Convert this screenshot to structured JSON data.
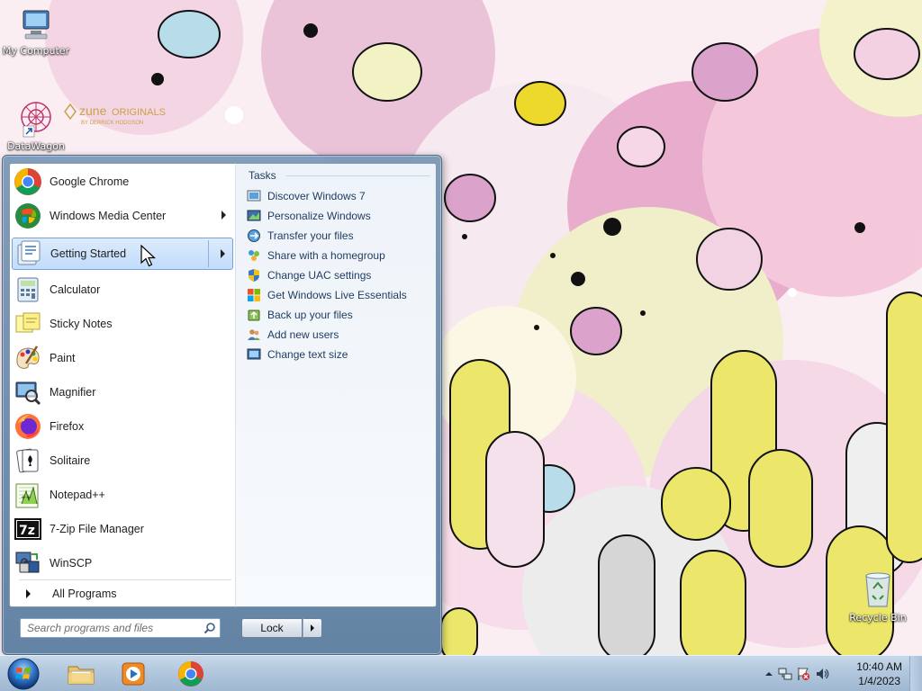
{
  "desktop": {
    "icons": [
      {
        "label": "My Computer",
        "icon": "computer-icon"
      },
      {
        "label": "DataWagon",
        "icon": "datawagon-shortcut-icon"
      },
      {
        "label": "Recycle Bin",
        "icon": "recycle-bin-icon"
      }
    ],
    "zune_logo": {
      "brand": "zune",
      "tagline": "ORIGINALS",
      "credit": "BY DERRICK HODGSON"
    }
  },
  "start_menu": {
    "programs": [
      {
        "label": "Google Chrome",
        "icon": "chrome-icon",
        "has_submenu": false,
        "selected": false
      },
      {
        "label": "Windows Media Center",
        "icon": "media-center-icon",
        "has_submenu": true,
        "selected": false
      },
      {
        "label": "Getting Started",
        "icon": "getting-started-icon",
        "has_submenu": true,
        "selected": true
      },
      {
        "label": "Calculator",
        "icon": "calculator-icon",
        "has_submenu": false,
        "selected": false
      },
      {
        "label": "Sticky Notes",
        "icon": "sticky-notes-icon",
        "has_submenu": false,
        "selected": false
      },
      {
        "label": "Paint",
        "icon": "paint-icon",
        "has_submenu": false,
        "selected": false
      },
      {
        "label": "Magnifier",
        "icon": "magnifier-icon",
        "has_submenu": false,
        "selected": false
      },
      {
        "label": "Firefox",
        "icon": "firefox-icon",
        "has_submenu": false,
        "selected": false
      },
      {
        "label": "Solitaire",
        "icon": "solitaire-icon",
        "has_submenu": false,
        "selected": false
      },
      {
        "label": "Notepad++",
        "icon": "notepad-plus-plus-icon",
        "has_submenu": false,
        "selected": false
      },
      {
        "label": "7-Zip File Manager",
        "icon": "7zip-icon",
        "has_submenu": false,
        "selected": false
      },
      {
        "label": "WinSCP",
        "icon": "winscp-icon",
        "has_submenu": false,
        "selected": false
      }
    ],
    "all_programs_label": "All Programs",
    "tasks_title": "Tasks",
    "tasks": [
      {
        "label": "Discover Windows 7",
        "icon": "discover-icon"
      },
      {
        "label": "Personalize Windows",
        "icon": "personalize-icon"
      },
      {
        "label": "Transfer your files",
        "icon": "transfer-icon"
      },
      {
        "label": "Share with a homegroup",
        "icon": "homegroup-icon"
      },
      {
        "label": "Change UAC settings",
        "icon": "uac-shield-icon"
      },
      {
        "label": "Get Windows Live Essentials",
        "icon": "windows-flag-icon"
      },
      {
        "label": "Back up your files",
        "icon": "backup-icon"
      },
      {
        "label": "Add new users",
        "icon": "users-icon"
      },
      {
        "label": "Change text size",
        "icon": "text-size-icon"
      }
    ],
    "search": {
      "placeholder": "Search programs and files"
    },
    "lock_label": "Lock"
  },
  "taskbar": {
    "pinned": [
      {
        "name": "explorer",
        "icon": "folder-icon"
      },
      {
        "name": "media-player",
        "icon": "media-player-icon"
      },
      {
        "name": "chrome",
        "icon": "chrome-icon"
      }
    ],
    "clock": {
      "time": "10:40 AM",
      "date": "1/4/2023"
    }
  },
  "colors": {
    "accent": "#7da2ce",
    "selection_top": "#dcebfc",
    "selection_bottom": "#c1dcfc",
    "task_text": "#1e3a5f",
    "taskbar": "#b4c9df"
  }
}
